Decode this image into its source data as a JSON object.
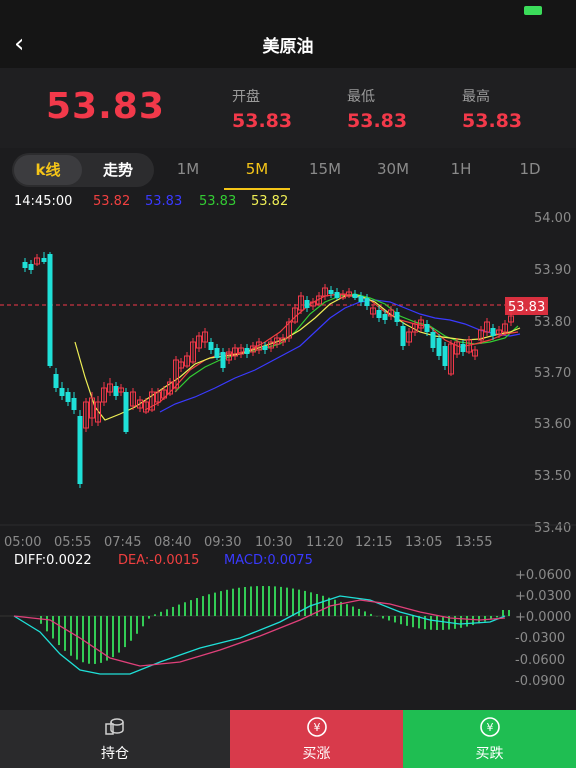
{
  "app": {
    "title": "美原油",
    "back_icon": "‹"
  },
  "quote": {
    "last": "53.83",
    "open_label": "开盘",
    "open": "53.83",
    "low_label": "最低",
    "low": "53.83",
    "high_label": "最高",
    "high": "53.83"
  },
  "mode_tabs": [
    "k线",
    "走势"
  ],
  "period_tabs": [
    "1M",
    "5M",
    "15M",
    "30M",
    "1H",
    "1D"
  ],
  "active_period": "5M",
  "colors": {
    "up": "#f2394a",
    "down": "#1fe0d8",
    "ma5": "#f04040",
    "ma10": "#3a3aff",
    "ma20": "#33cc33",
    "ma30": "#eeee55",
    "bg": "#1c1c1e"
  },
  "ma_header": {
    "time": "14:45:00",
    "v1": "53.82",
    "v2": "53.83",
    "v3": "53.83",
    "v4": "53.82"
  },
  "price_axis": [
    "54.00",
    "53.90",
    "53.80",
    "53.70",
    "53.60",
    "53.50",
    "53.40"
  ],
  "current_price_tag": "53.83",
  "time_axis": [
    "05:00",
    "05:55",
    "07:45",
    "08:40",
    "09:30",
    "10:30",
    "11:20",
    "12:15",
    "13:05",
    "13:55"
  ],
  "macd_header": {
    "diff": "DIFF:0.0022",
    "dea": "DEA:-0.0015",
    "macd": "MACD:0.0075"
  },
  "macd_axis": [
    "+0.0600",
    "+0.0300",
    "+0.0000",
    "-0.0300",
    "-0.0600",
    "-0.0900"
  ],
  "footer": {
    "hold": "持仓",
    "buy_up": "买涨",
    "buy_down": "买跌"
  }
}
